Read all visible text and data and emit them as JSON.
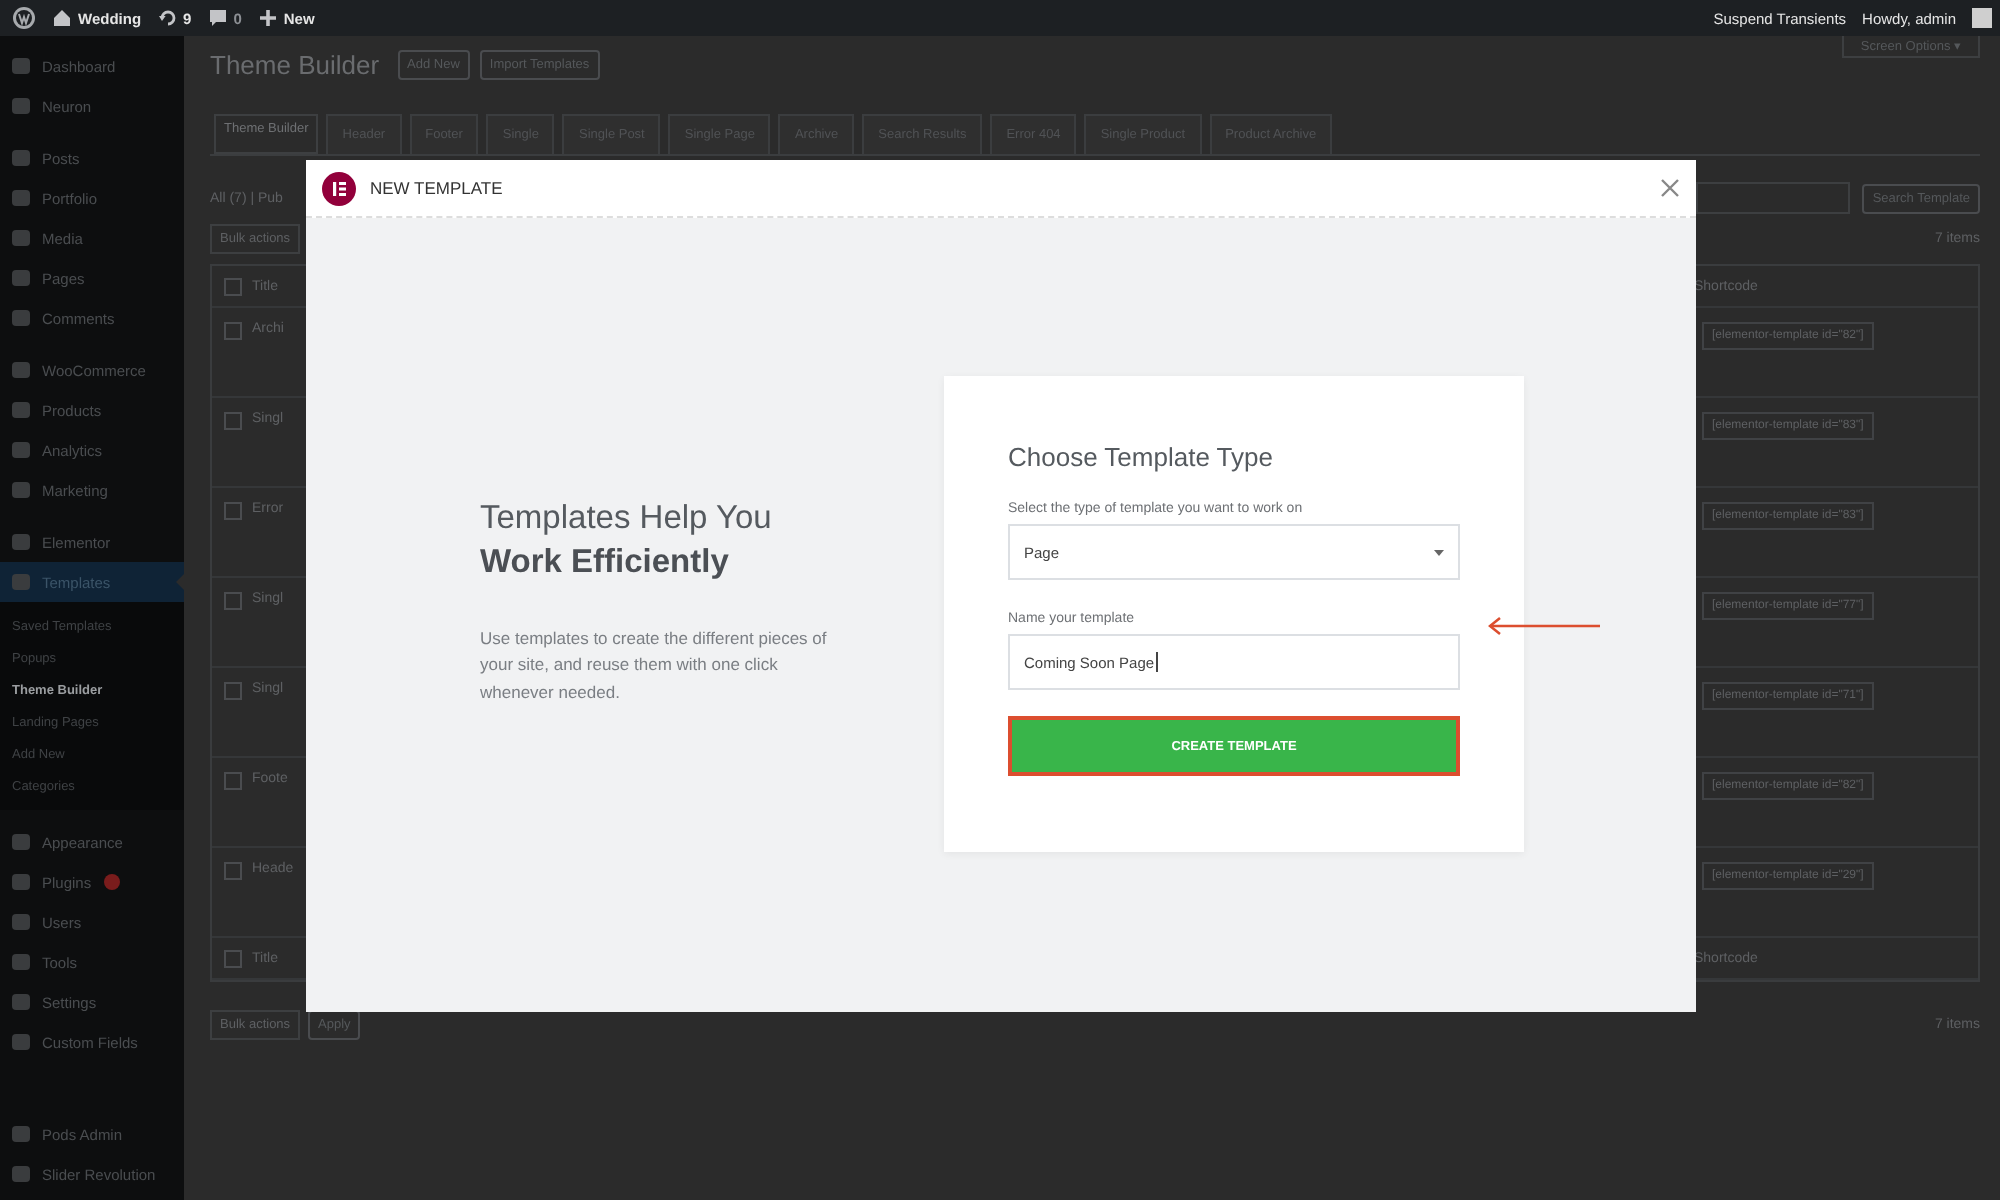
{
  "admin_bar": {
    "site": "Wedding",
    "updates": "9",
    "comments": "0",
    "new": "New",
    "links": [
      "Suspend Transients",
      "Howdy, admin"
    ]
  },
  "sidebar": {
    "sections": [
      {
        "items": [
          {
            "label": "Dashboard",
            "selected": false
          },
          {
            "label": "Neuron",
            "selected": false
          }
        ]
      },
      {
        "items": [
          {
            "label": "Posts",
            "selected": false
          },
          {
            "label": "Portfolio",
            "selected": false
          },
          {
            "label": "Media",
            "selected": false
          },
          {
            "label": "Pages",
            "selected": false
          },
          {
            "label": "Comments",
            "selected": false
          }
        ]
      },
      {
        "items": [
          {
            "label": "WooCommerce",
            "selected": false
          },
          {
            "label": "Products",
            "selected": false
          },
          {
            "label": "Analytics",
            "selected": false
          },
          {
            "label": "Marketing",
            "selected": false
          }
        ]
      },
      {
        "items": [
          {
            "label": "Elementor",
            "selected": false
          },
          {
            "label": "Templates",
            "selected": true,
            "children": [
              {
                "label": "Saved Templates",
                "selected": false
              },
              {
                "label": "Popups",
                "selected": false
              },
              {
                "label": "Theme Builder",
                "selected": true
              },
              {
                "label": "Landing Pages",
                "selected": false
              },
              {
                "label": "Add New",
                "selected": false
              },
              {
                "label": "Categories",
                "selected": false
              }
            ]
          }
        ]
      },
      {
        "items": [
          {
            "label": "Appearance",
            "selected": false
          },
          {
            "label": "Plugins",
            "selected": false,
            "badge": true
          },
          {
            "label": "Users",
            "selected": false
          },
          {
            "label": "Tools",
            "selected": false
          },
          {
            "label": "Settings",
            "selected": false
          },
          {
            "label": "Custom Fields",
            "selected": false
          }
        ]
      },
      {
        "items": [
          {
            "label": "Pods Admin",
            "selected": false
          },
          {
            "label": "Slider Revolution",
            "selected": false
          }
        ]
      }
    ]
  },
  "page": {
    "title": "Theme Builder",
    "buttons": [
      "Add New",
      "Import Templates"
    ],
    "screen_options": "Screen Options ▾",
    "tabs": [
      {
        "label": "Theme Builder",
        "selected": true
      },
      {
        "label": "Header",
        "selected": false
      },
      {
        "label": "Footer",
        "selected": false
      },
      {
        "label": "Single",
        "selected": false
      },
      {
        "label": "Single Post",
        "selected": false
      },
      {
        "label": "Single Page",
        "selected": false
      },
      {
        "label": "Archive",
        "selected": false
      },
      {
        "label": "Search Results",
        "selected": false
      },
      {
        "label": "Error 404",
        "selected": false
      },
      {
        "label": "Single Product",
        "selected": false
      },
      {
        "label": "Product Archive",
        "selected": false
      }
    ],
    "filter": "All (7) | Pub",
    "bulk_actions": "Bulk actions",
    "search_button": "Search Template",
    "item_count": "7 items",
    "table": {
      "columns": [
        "Title",
        "Shortcode"
      ],
      "select_all_checked": false,
      "rows": [
        {
          "checked": false,
          "title": "Archi",
          "shortcode": "[elementor-template id=\"82\"]"
        },
        {
          "checked": false,
          "title": "Singl",
          "shortcode": "[elementor-template id=\"83\"]"
        },
        {
          "checked": false,
          "title": "Error",
          "shortcode": "[elementor-template id=\"83\"]"
        },
        {
          "checked": false,
          "title": "Singl",
          "shortcode": "[elementor-template id=\"77\"]"
        },
        {
          "checked": false,
          "title": "Singl",
          "shortcode": "[elementor-template id=\"71\"]"
        },
        {
          "checked": false,
          "title": "Foote",
          "shortcode": "[elementor-template id=\"82\"]"
        },
        {
          "checked": false,
          "title": "Heade",
          "shortcode": "[elementor-template id=\"29\"]"
        }
      ],
      "footer_columns": [
        "Title",
        "Shortcode"
      ],
      "footer_select_all_checked": false
    },
    "bottom": {
      "bulk_actions": "Bulk actions",
      "apply": "Apply",
      "item_count": "7 items"
    }
  },
  "modal": {
    "title": "NEW TEMPLATE",
    "heading": "Templates Help You",
    "heading_bold": "Work Efficiently",
    "text": "Use templates to create the different pieces of your site, and reuse them with one click whenever needed.",
    "form": {
      "title": "Choose Template Type",
      "type_label": "Select the type of template you want to work on",
      "type_value": "Page",
      "name_label": "Name your template",
      "name_value": "Coming Soon Page",
      "button": {
        "label": "CREATE TEMPLATE",
        "highlighted": true
      }
    },
    "pointer_arrow": true
  }
}
